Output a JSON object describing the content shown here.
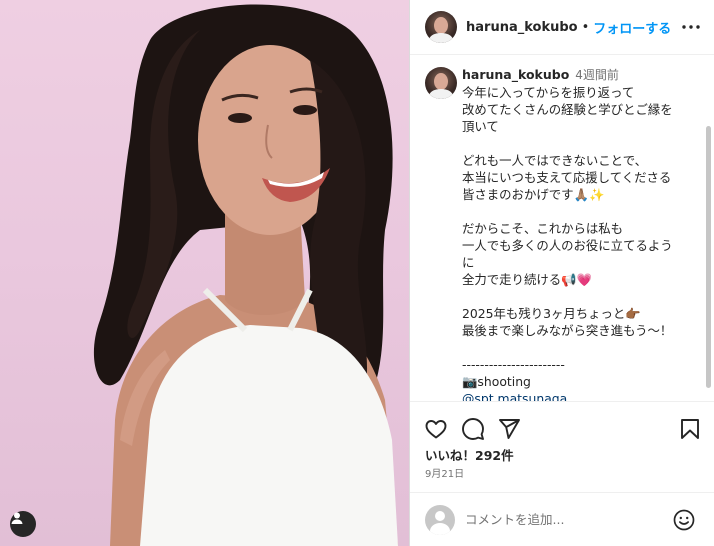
{
  "post": {
    "username": "haruna_kokubo",
    "separator": "•",
    "follow_label": "フォローする",
    "more_icon": "more-horizontal-icon"
  },
  "caption": {
    "username": "haruna_kokubo",
    "time_ago": "4週間前",
    "text": "今年に入ってからを振り返って\n改めてたくさんの経験と学びとご縁を\n頂いて\n\nどれも一人ではできないことで、\n本当にいつも支えて応援してくださる\n皆さまのおかげです🙏🏽✨\n\nだからこそ、これからは私も\n一人でも多くの人のお役に立てるよう\nに\n全力で走り続ける📢💗\n\n2025年も残り3ヶ月ちょっと👉🏾\n最後まで楽しみながら突き進もう〜！\n\n-----------------------\n📷shooting",
    "link": "@spt.matsunaga"
  },
  "actions": {
    "like_icon": "heart-icon",
    "comment_icon": "comment-icon",
    "share_icon": "send-icon",
    "save_icon": "bookmark-icon"
  },
  "likes_text": "いいね！292件",
  "date_text": "9月21日",
  "comment": {
    "placeholder": "コメントを追加...",
    "emoji_icon": "smile-icon"
  },
  "colors": {
    "accent": "#0095f6",
    "link": "#00376b",
    "muted": "#737373",
    "photo_background": "#ebc9de"
  }
}
